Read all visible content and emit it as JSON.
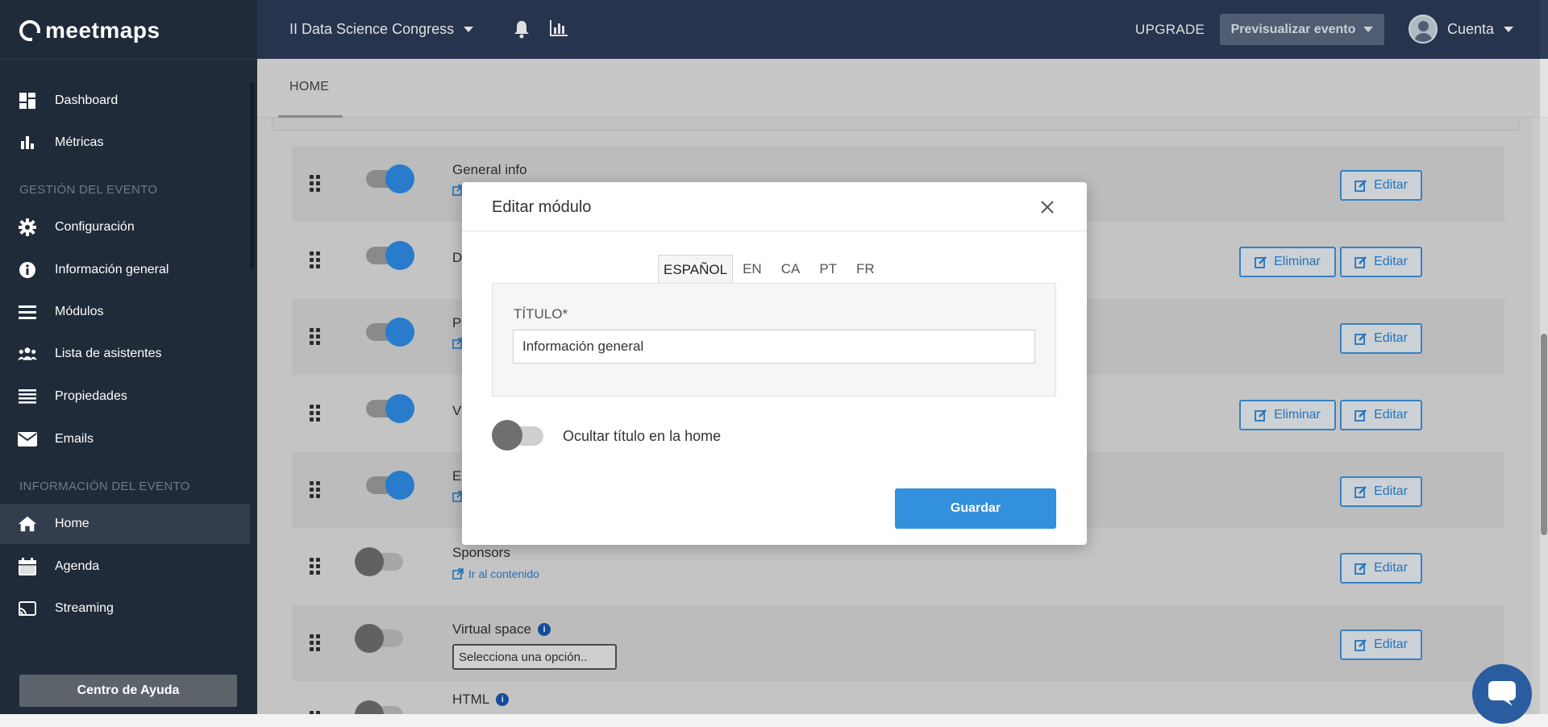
{
  "brand": {
    "name": "meetmaps"
  },
  "header": {
    "event_name": "II Data Science Congress",
    "upgrade_label": "UPGRADE",
    "preview_label": "Previsualizar evento",
    "account_label": "Cuenta"
  },
  "sidebar": {
    "items_top": [
      {
        "label": "Dashboard",
        "icon": "dashboard-icon"
      },
      {
        "label": "Métricas",
        "icon": "bar-chart-icon"
      }
    ],
    "section_event": "GESTIÓN DEL EVENTO",
    "items_event": [
      {
        "label": "Configuración",
        "icon": "gear-icon"
      },
      {
        "label": "Información general",
        "icon": "info-icon"
      },
      {
        "label": "Módulos",
        "icon": "menu-icon"
      },
      {
        "label": "Lista de asistentes",
        "icon": "users-icon"
      },
      {
        "label": "Propiedades",
        "icon": "list-icon"
      },
      {
        "label": "Emails",
        "icon": "envelope-icon"
      }
    ],
    "section_info": "INFORMACIÓN DEL EVENTO",
    "items_info": [
      {
        "label": "Home",
        "icon": "home-icon",
        "active": true
      },
      {
        "label": "Agenda",
        "icon": "calendar-icon"
      },
      {
        "label": "Streaming",
        "icon": "cast-icon"
      }
    ],
    "help_label": "Centro de Ayuda"
  },
  "tabs": {
    "active": "HOME"
  },
  "modules": [
    {
      "title": "General info",
      "prefix": "",
      "enabled": true,
      "has_delete": false,
      "has_link": true
    },
    {
      "title": "",
      "prefix": "D",
      "enabled": true,
      "has_delete": true,
      "has_link": false
    },
    {
      "title": "",
      "prefix": "P",
      "enabled": true,
      "has_delete": false,
      "has_link": true
    },
    {
      "title": "",
      "prefix": "V",
      "enabled": true,
      "has_delete": true,
      "has_link": false
    },
    {
      "title": "",
      "prefix": "E",
      "enabled": true,
      "has_delete": false,
      "has_link": true
    },
    {
      "title": "Sponsors",
      "prefix": "",
      "enabled": false,
      "has_delete": false,
      "has_link": true,
      "link_label": "Ir al contenido"
    },
    {
      "title": "Virtual space",
      "prefix": "",
      "enabled": false,
      "has_delete": false,
      "has_info": true,
      "select_value": "Selecciona una opción.."
    },
    {
      "title": "HTML",
      "prefix": "",
      "enabled": false,
      "has_delete": false,
      "has_info": true
    }
  ],
  "buttons": {
    "edit": "Editar",
    "delete": "Eliminar"
  },
  "modal": {
    "title": "Editar módulo",
    "languages": [
      "ESPAÑOL",
      "EN",
      "CA",
      "PT",
      "FR"
    ],
    "active_language": "ESPAÑOL",
    "field_label": "TÍTULO*",
    "field_value": "Información general",
    "hide_title_label": "Ocultar título en la home",
    "hide_title_enabled": false,
    "save_label": "Guardar"
  },
  "colors": {
    "sidebar_bg": "#1f2b39",
    "header_bg": "#2d3c59",
    "accent": "#3290dd",
    "toggle_on": "#2e8ee8"
  }
}
